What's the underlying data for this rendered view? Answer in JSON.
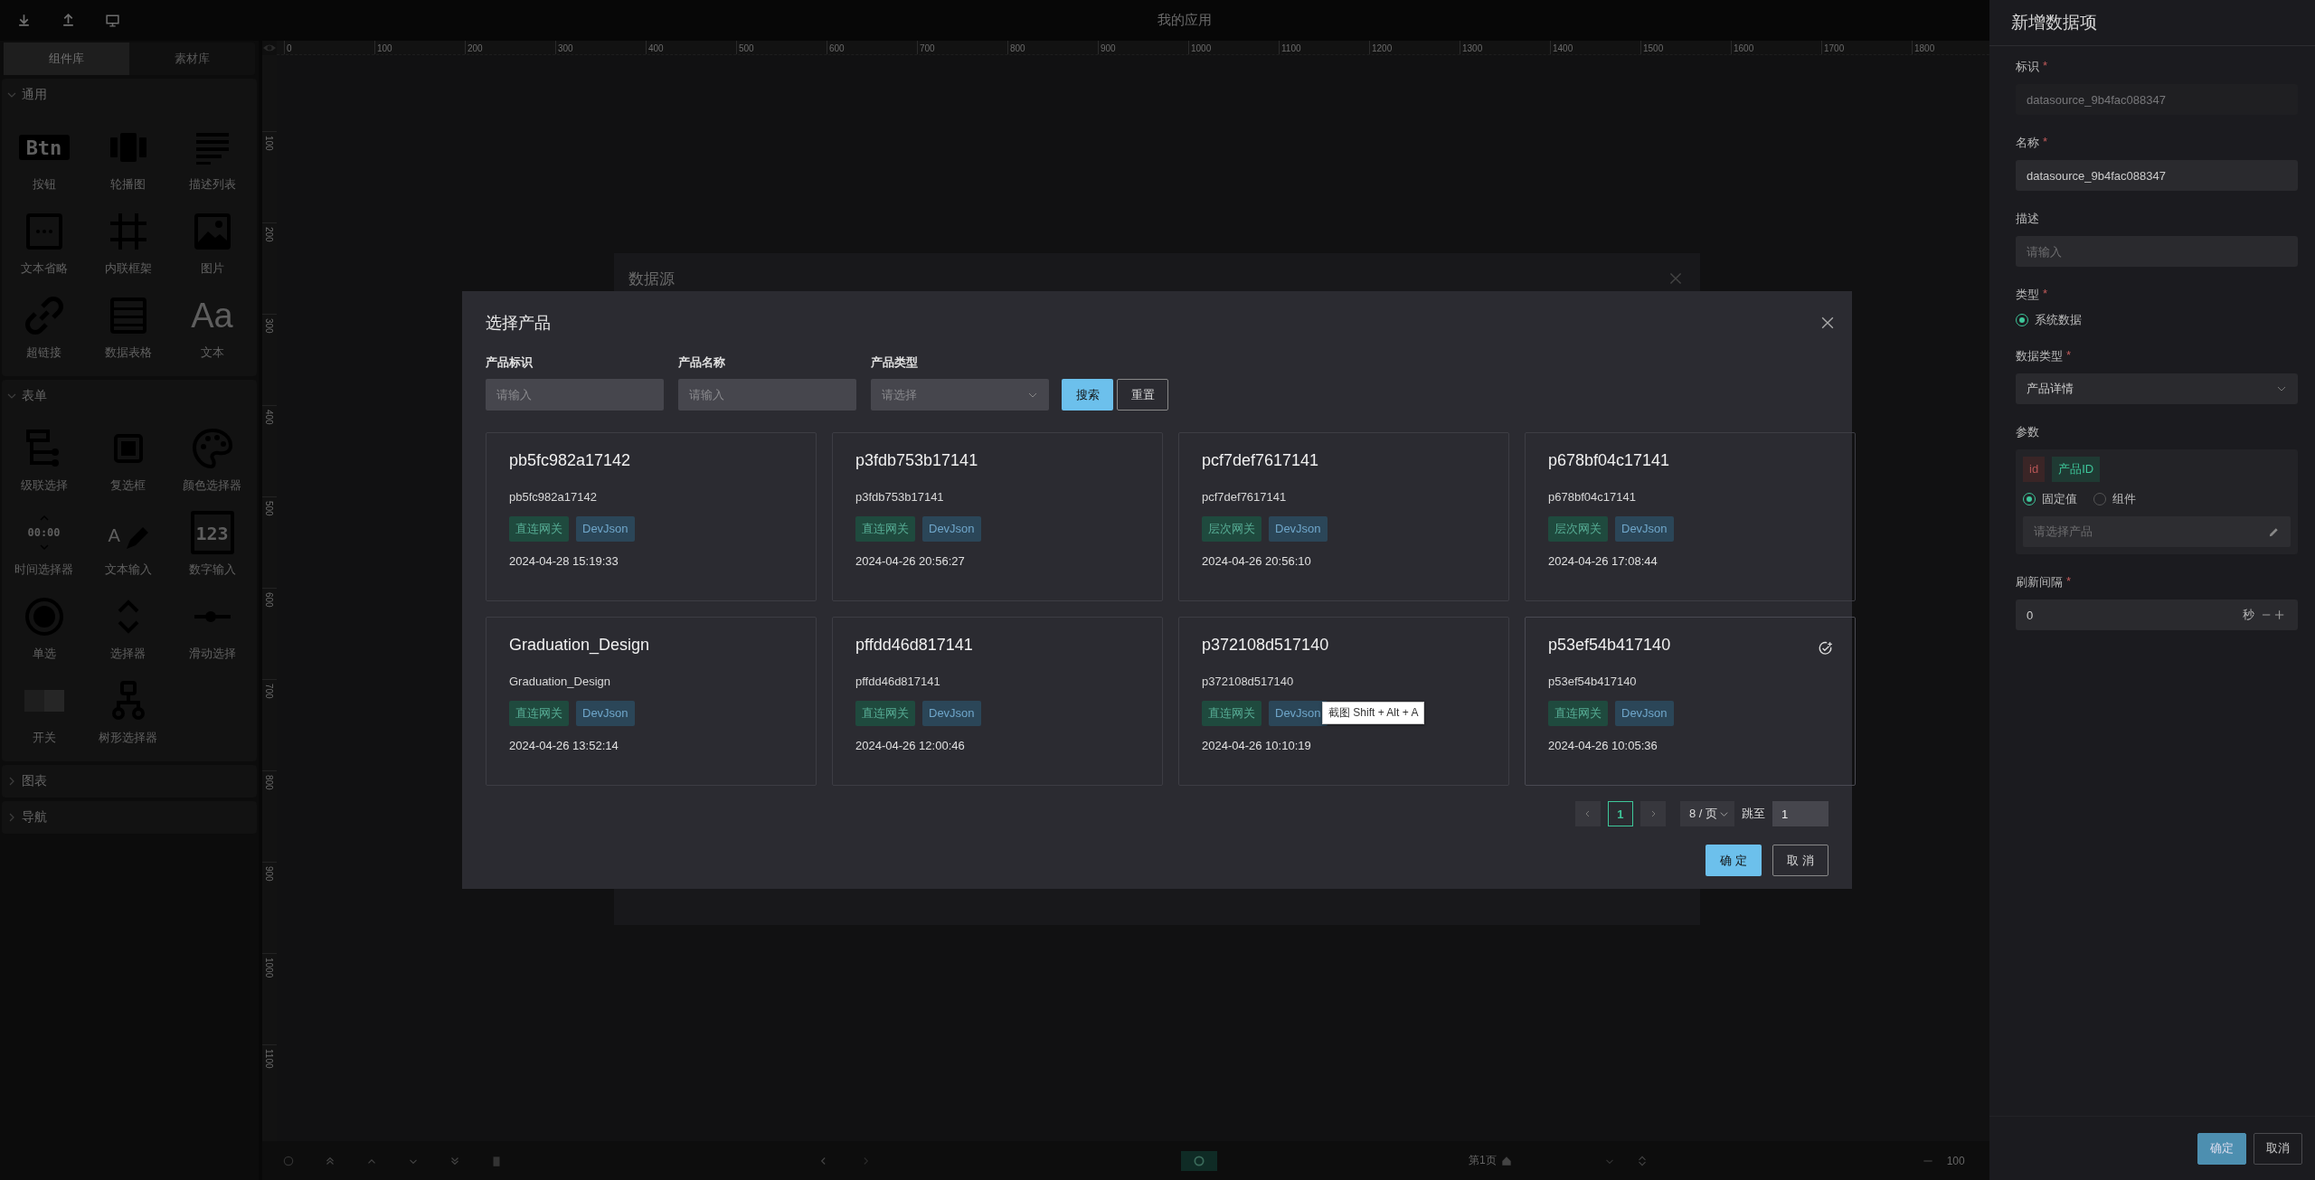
{
  "top_bar": {
    "title": "我的应用"
  },
  "sidebar": {
    "tabs": [
      {
        "label": "组件库",
        "selected": true
      },
      {
        "label": "素材库",
        "selected": false
      }
    ],
    "groups": [
      {
        "title": "通用",
        "expanded": true,
        "items": [
          {
            "label": "按钮",
            "kind": "button",
            "icon_text": "Btn"
          },
          {
            "label": "轮播图",
            "kind": "carousel"
          },
          {
            "label": "描述列表",
            "kind": "list"
          },
          {
            "label": "文本省略",
            "kind": "ellipsis"
          },
          {
            "label": "内联框架",
            "kind": "iframe"
          },
          {
            "label": "图片",
            "kind": "image"
          },
          {
            "label": "超链接",
            "kind": "link"
          },
          {
            "label": "数据表格",
            "kind": "table"
          },
          {
            "label": "文本",
            "kind": "text",
            "icon_text": "Aa"
          }
        ]
      },
      {
        "title": "表单",
        "expanded": true,
        "items": [
          {
            "label": "级联选择",
            "kind": "cascader"
          },
          {
            "label": "复选框",
            "kind": "checkbox"
          },
          {
            "label": "颜色选择器",
            "kind": "color"
          },
          {
            "label": "时间选择器",
            "kind": "time",
            "icon_text": "00:00"
          },
          {
            "label": "文本输入",
            "kind": "textinput",
            "icon_text": "A"
          },
          {
            "label": "数字输入",
            "kind": "number",
            "icon_text": "123"
          },
          {
            "label": "单选",
            "kind": "radio"
          },
          {
            "label": "选择器",
            "kind": "select"
          },
          {
            "label": "滑动选择",
            "kind": "slider"
          },
          {
            "label": "开关",
            "kind": "switch"
          },
          {
            "label": "树形选择器",
            "kind": "tree"
          }
        ]
      },
      {
        "title": "图表",
        "expanded": false
      },
      {
        "title": "导航",
        "expanded": false
      }
    ]
  },
  "ruler": {
    "x_labels": [
      "0",
      "100",
      "200",
      "300",
      "400",
      "500",
      "600",
      "700",
      "800",
      "900",
      "1000",
      "1100",
      "1200",
      "1300",
      "1400",
      "1500",
      "1600",
      "1700",
      "1800"
    ],
    "y_labels": [
      "100",
      "200",
      "300",
      "400",
      "500",
      "600",
      "700",
      "800",
      "900",
      "1000",
      "1100"
    ]
  },
  "background_dialog": {
    "title": "数据源"
  },
  "bottom_bar": {
    "page_label": "第1页",
    "zoom": "100"
  },
  "modal": {
    "title": "选择产品",
    "filters": [
      {
        "label": "产品标识",
        "placeholder": "请输入",
        "kind": "input"
      },
      {
        "label": "产品名称",
        "placeholder": "请输入",
        "kind": "input"
      },
      {
        "label": "产品类型",
        "placeholder": "请选择",
        "kind": "select"
      }
    ],
    "search_button": "搜索",
    "reset_button": "重置",
    "products": [
      {
        "title": "pb5fc982a17142",
        "id": "pb5fc982a17142",
        "tags": [
          {
            "label": "直连网关",
            "color": "#1f4a3e"
          },
          {
            "label": "DevJson",
            "color": "#2b4658"
          }
        ],
        "time": "2024-04-28 15:19:33",
        "hovered": false
      },
      {
        "title": "p3fdb753b17141",
        "id": "p3fdb753b17141",
        "tags": [
          {
            "label": "直连网关",
            "color": "#1f4a3e"
          },
          {
            "label": "DevJson",
            "color": "#2b4658"
          }
        ],
        "time": "2024-04-26 20:56:27",
        "hovered": false
      },
      {
        "title": "pcf7def7617141",
        "id": "pcf7def7617141",
        "tags": [
          {
            "label": "层次网关",
            "color": "#1f4a3e"
          },
          {
            "label": "DevJson",
            "color": "#2b4658"
          }
        ],
        "time": "2024-04-26 20:56:10",
        "hovered": false
      },
      {
        "title": "p678bf04c17141",
        "id": "p678bf04c17141",
        "tags": [
          {
            "label": "层次网关",
            "color": "#1f4a3e"
          },
          {
            "label": "DevJson",
            "color": "#2b4658"
          }
        ],
        "time": "2024-04-26 17:08:44",
        "hovered": false
      },
      {
        "title": "Graduation_Design",
        "id": "Graduation_Design",
        "tags": [
          {
            "label": "直连网关",
            "color": "#1f4a3e"
          },
          {
            "label": "DevJson",
            "color": "#2b4658"
          }
        ],
        "time": "2024-04-26 13:52:14",
        "hovered": false
      },
      {
        "title": "pffdd46d817141",
        "id": "pffdd46d817141",
        "tags": [
          {
            "label": "直连网关",
            "color": "#1f4a3e"
          },
          {
            "label": "DevJson",
            "color": "#2b4658"
          }
        ],
        "time": "2024-04-26 12:00:46",
        "hovered": false
      },
      {
        "title": "p372108d517140",
        "id": "p372108d517140",
        "tags": [
          {
            "label": "直连网关",
            "color": "#1f4a3e"
          },
          {
            "label": "DevJson",
            "color": "#2b4658"
          }
        ],
        "time": "2024-04-26 10:10:19",
        "hovered": false
      },
      {
        "title": "p53ef54b417140",
        "id": "p53ef54b417140",
        "tags": [
          {
            "label": "直连网关",
            "color": "#1f4a3e"
          },
          {
            "label": "DevJson",
            "color": "#2b4658"
          }
        ],
        "time": "2024-04-26 10:05:36",
        "hovered": true
      }
    ],
    "pagination": {
      "pages": [
        {
          "label": "1",
          "selected": true
        }
      ],
      "page_size": "8 / 页",
      "jump_label": "跳至",
      "jump_value": "1"
    },
    "ok_button": "确 定",
    "cancel_button": "取 消"
  },
  "tooltip": {
    "text": "截图 Shift + Alt + A"
  },
  "drawer": {
    "title": "新增数据项",
    "fields": [
      {
        "kind": "input",
        "label": "标识",
        "required_mark": "*",
        "value": "datasource_9b4fac088347",
        "disabled": true
      },
      {
        "kind": "input",
        "label": "名称",
        "required_mark": "*",
        "value": "datasource_9b4fac088347",
        "disabled": false
      },
      {
        "kind": "input",
        "label": "描述",
        "placeholder": "请输入",
        "disabled": false
      },
      {
        "kind": "radio",
        "label": "类型",
        "required_mark": "*",
        "options": [
          {
            "label": "系统数据",
            "selected": true
          }
        ]
      },
      {
        "kind": "select",
        "label": "数据类型",
        "required_mark": "*",
        "value": "产品详情"
      },
      {
        "kind": "params",
        "label": "参数",
        "key": "id",
        "name": "产品ID",
        "options": [
          {
            "label": "固定值",
            "selected": true
          },
          {
            "label": "组件",
            "selected": false
          }
        ],
        "placeholder": "请选择产品"
      },
      {
        "kind": "number",
        "label": "刷新间隔",
        "required_mark": "*",
        "value": "0",
        "unit": "秒"
      }
    ],
    "buttons": [
      {
        "label": "确定",
        "primary": true
      },
      {
        "label": "取消",
        "primary": false
      }
    ]
  }
}
